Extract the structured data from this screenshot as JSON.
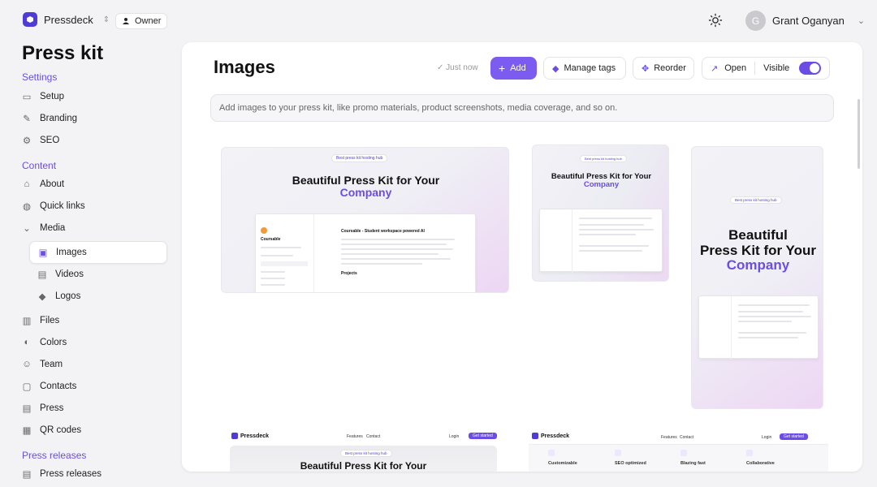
{
  "topbar": {
    "app_name": "Pressdeck",
    "role": "Owner",
    "user_name": "Grant Oganyan",
    "avatar_initial": "G"
  },
  "sidebar": {
    "title": "Press kit",
    "sections": {
      "settings": "Settings",
      "content": "Content",
      "press_releases": "Press releases"
    },
    "items": {
      "setup": "Setup",
      "branding": "Branding",
      "seo": "SEO",
      "about": "About",
      "quick_links": "Quick links",
      "media": "Media",
      "images": "Images",
      "videos": "Videos",
      "logos": "Logos",
      "files": "Files",
      "colors": "Colors",
      "team": "Team",
      "contacts": "Contacts",
      "press": "Press",
      "qr_codes": "QR codes",
      "press_releases": "Press releases"
    }
  },
  "main": {
    "title": "Images",
    "saved_status": "Just now",
    "toolbar": {
      "add_label": "Add",
      "manage_tags_label": "Manage tags",
      "reorder_label": "Reorder",
      "open_label": "Open",
      "visible_label": "Visible",
      "visible_on": true
    },
    "hint": "Add images to your press kit, like promo materials, product screenshots, media coverage, and so on.",
    "images": [
      {
        "badge": "Best press kit hosting hub",
        "headline": "Beautiful Press Kit for Your",
        "accent": "Company",
        "app_title": "Coursable",
        "doc_title": "Coursable - Student workspace powered AI",
        "section": "Projects"
      },
      {
        "badge": "Best press kit hosting hub",
        "headline": "Beautiful Press Kit for Your",
        "accent": "Company"
      },
      {
        "badge": "Best press kit hosting hub",
        "headline_1": "Beautiful",
        "headline_2": "Press Kit for Your",
        "accent": "Company"
      },
      {
        "brand": "Pressdeck",
        "nav_1": "Features",
        "nav_2": "Contact",
        "login": "Login",
        "cta": "Get started",
        "badge": "Best press kit hosting hub",
        "headline": "Beautiful Press Kit for Your"
      },
      {
        "brand": "Pressdeck",
        "nav_1": "Features",
        "nav_2": "Contact",
        "login": "Login",
        "cta": "Get started",
        "features": [
          "Customizable",
          "SEO optimized",
          "Blazing fast",
          "Collaborative"
        ]
      }
    ]
  },
  "colors": {
    "accent": "#7c5cf0",
    "accent_text": "#6b4de6",
    "brand": "#4f3bd6"
  }
}
